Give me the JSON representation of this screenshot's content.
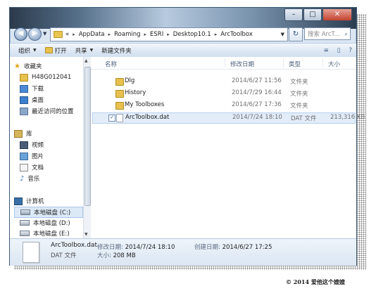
{
  "window": {
    "controls": {
      "minimize": "–",
      "maximize": "□",
      "close": "✕"
    }
  },
  "address": {
    "back_glyph": "◀",
    "forward_glyph": "▶",
    "crumbs": [
      "AppData",
      "Roaming",
      "ESRI",
      "Desktop10.1",
      "ArcToolbox"
    ],
    "separator": "▸",
    "overflow": "«",
    "dropdown": "▼",
    "refresh_glyph": "↻",
    "search_placeholder": "搜索 ArcT...",
    "search_icon": "⌕"
  },
  "toolbar": {
    "organize": "组织",
    "open": "打开",
    "share": "共享",
    "new_folder": "新建文件夹",
    "arrow": "▼",
    "right_icons": [
      "≡",
      "▯",
      "?"
    ]
  },
  "nav": {
    "favorites": "收藏夹",
    "h48": "H48G012041",
    "downloads": "下载",
    "desktop": "桌面",
    "recent": "最近访问的位置",
    "libraries": "库",
    "videos": "视频",
    "pictures": "图片",
    "documents": "文档",
    "music": "音乐",
    "computer": "计算机",
    "drive_c": "本地磁盘 (C:)",
    "drive_d": "本地磁盘 (D:)",
    "drive_e": "本地磁盘 (E:)"
  },
  "columns": {
    "name": "名称",
    "modified": "修改日期",
    "type": "类型",
    "size": "大小"
  },
  "files": [
    {
      "name": "Dlg",
      "modified": "2014/6/27 11:56",
      "type": "文件夹",
      "size": ""
    },
    {
      "name": "History",
      "modified": "2014/7/29 16:44",
      "type": "文件夹",
      "size": ""
    },
    {
      "name": "My Toolboxes",
      "modified": "2014/6/27 17:36",
      "type": "文件夹",
      "size": ""
    },
    {
      "name": "ArcToolbox.dat",
      "modified": "2014/7/24 18:10",
      "type": "DAT 文件",
      "size": "213,316 KB"
    }
  ],
  "details": {
    "name": "ArcToolbox.dat",
    "kind": "DAT 文件",
    "modified_label": "修改日期:",
    "modified_value": "2014/7/24 18:10",
    "created_label": "创建日期:",
    "created_value": "2014/6/27 17:25",
    "size_label": "大小:",
    "size_value": "208 MB"
  },
  "footer": "© 2014  爱他这个嫂嫂",
  "checkmark": "✓"
}
